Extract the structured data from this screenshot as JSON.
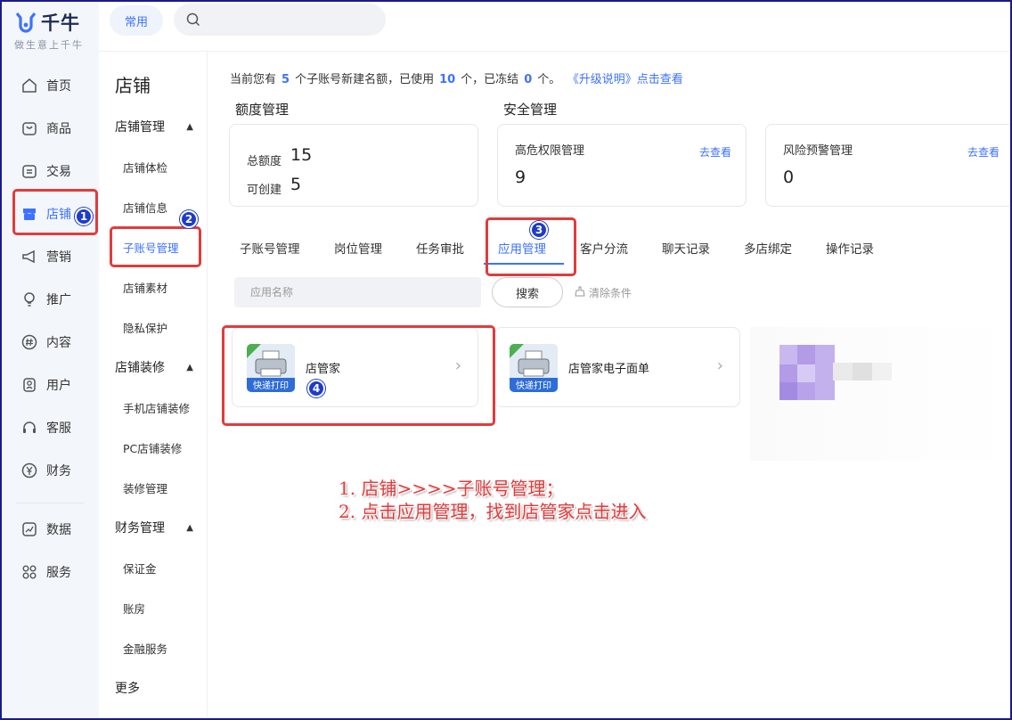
{
  "logo": {
    "name": "千牛",
    "tagline": "做生意上千牛"
  },
  "nav": {
    "items": [
      {
        "label": "首页",
        "icon": "home-icon"
      },
      {
        "label": "商品",
        "icon": "goods-icon"
      },
      {
        "label": "交易",
        "icon": "trade-icon"
      },
      {
        "label": "店铺",
        "icon": "store-icon",
        "active": true
      },
      {
        "label": "营销",
        "icon": "megaphone-icon"
      },
      {
        "label": "推广",
        "icon": "bulb-icon"
      },
      {
        "label": "内容",
        "icon": "hash-icon"
      },
      {
        "label": "用户",
        "icon": "user-icon"
      },
      {
        "label": "客服",
        "icon": "headset-icon"
      },
      {
        "label": "财务",
        "icon": "yen-icon"
      },
      {
        "label": "数据",
        "icon": "chart-icon"
      },
      {
        "label": "服务",
        "icon": "grid-icon"
      }
    ]
  },
  "topbar": {
    "chip_label": "常用",
    "search_placeholder": ""
  },
  "side2": {
    "title": "店铺",
    "group1": {
      "label": "店铺管理",
      "items": [
        "店铺体检",
        "店铺信息",
        "子账号管理",
        "店铺素材",
        "隐私保护"
      ]
    },
    "group2": {
      "label": "店铺装修",
      "items": [
        "手机店铺装修",
        "PC店铺装修",
        "装修管理"
      ]
    },
    "group3": {
      "label": "财务管理",
      "items": [
        "保证金",
        "账房",
        "金融服务"
      ]
    },
    "more": "更多"
  },
  "quota": {
    "prefix": "当前您有",
    "total": "5",
    "mid1": "个子账号新建名额，已使用",
    "used": "10",
    "mid2": "个，已冻结",
    "frozen": "0",
    "suffix": "个。",
    "link": "《升级说明》点击查看"
  },
  "sections": {
    "quota_title": "额度管理",
    "security_title": "安全管理"
  },
  "quota_card": {
    "total_label": "总额度",
    "total_value": "15",
    "creatable_label": "可创建",
    "creatable_value": "5"
  },
  "risk_card": {
    "label": "高危权限管理",
    "value": "9",
    "link": "去查看"
  },
  "warn_card": {
    "label": "风险预警管理",
    "value": "0",
    "link": "去查看"
  },
  "tabs": [
    "子账号管理",
    "岗位管理",
    "任务审批",
    "应用管理",
    "客户分流",
    "聊天记录",
    "多店绑定",
    "操作记录"
  ],
  "active_tab": "应用管理",
  "filter": {
    "placeholder": "应用名称",
    "search_label": "搜索",
    "clear_label": "清除条件"
  },
  "apps": [
    {
      "name": "店管家",
      "icon_caption": "快递打印"
    },
    {
      "name": "店管家电子面单",
      "icon_caption": "快递打印"
    }
  ],
  "badges": [
    "1",
    "2",
    "3",
    "4"
  ],
  "note": {
    "line1": "1. 店铺>>>>子账号管理；",
    "line2": "2. 点击应用管理，找到店管家点击进入"
  },
  "colors": {
    "accent": "#3d72ff",
    "annotation_red": "#e23b3b",
    "badge_blue": "#1e3cc8"
  }
}
